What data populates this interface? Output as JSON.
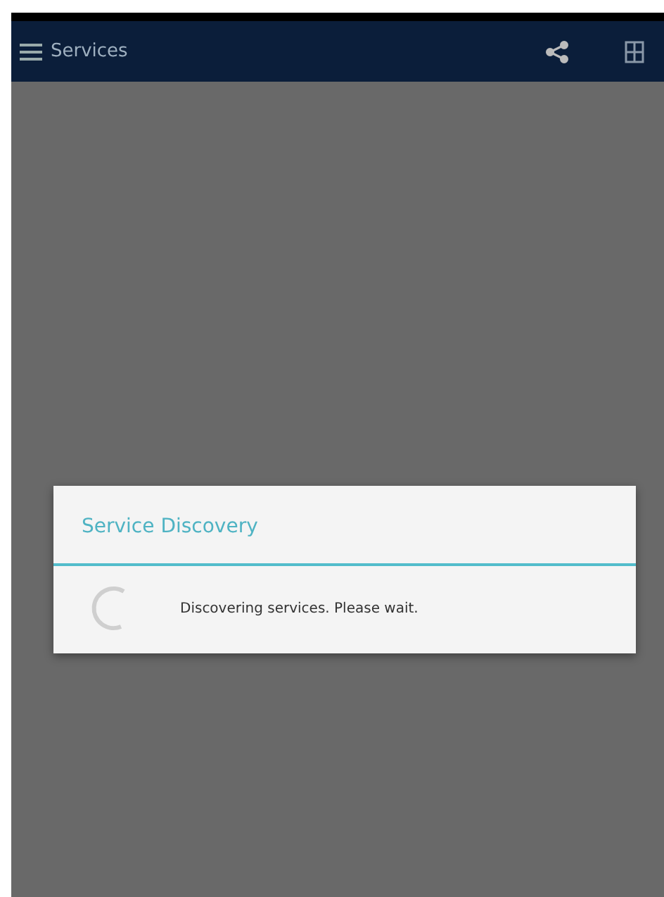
{
  "toolbar": {
    "title": "Services"
  },
  "dialog": {
    "title": "Service Discovery",
    "message": "Discovering services. Please wait."
  }
}
